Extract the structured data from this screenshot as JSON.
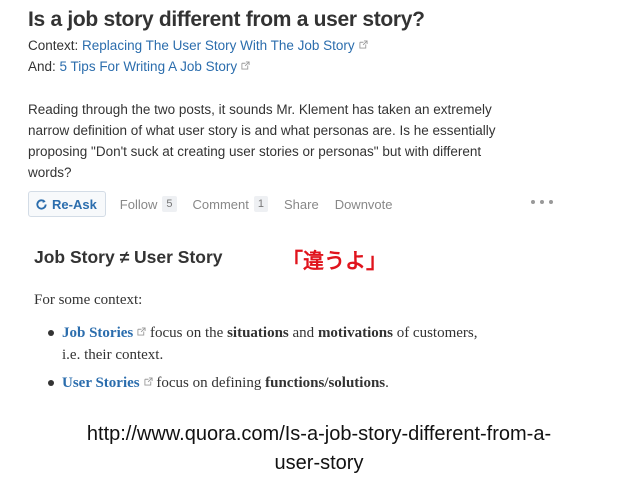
{
  "question": {
    "title": "Is a job story different from a user story?",
    "context_label": "Context:",
    "context_link": "Replacing The User Story With The Job Story",
    "and_label": "And:",
    "and_link": "5 Tips For Writing A Job Story",
    "body_lines": [
      "Reading through the two posts, it sounds Mr. Klement has taken an extremely",
      "narrow definition of what user story is and what personas are. Is he essentially",
      "proposing \"Don't suck at creating user stories or personas\" but with different",
      "words?"
    ]
  },
  "actions": {
    "reask": "Re-Ask",
    "follow": "Follow",
    "follow_count": "5",
    "comment": "Comment",
    "comment_count": "1",
    "share": "Share",
    "downvote": "Downvote"
  },
  "answer": {
    "title": "Job Story ≠ User Story",
    "annotation": "「違うよ」",
    "intro": "For some context:",
    "bullets": [
      {
        "link": "Job Stories",
        "text_a": " focus on the ",
        "bold_a": "situations",
        "text_b": " and ",
        "bold_b": "motivations",
        "text_c": " of customers,",
        "line2": "i.e. their context."
      },
      {
        "link": "User Stories",
        "text_a": " focus on defining ",
        "bold_a": "functions/solutions",
        "text_c": "."
      }
    ]
  },
  "source_url": {
    "line1": "http://www.quora.com/Is-a-job-story-different-from-a-",
    "line2": "user-story"
  },
  "colors": {
    "link": "#2b6dad",
    "annotation": "#e0141d",
    "text": "#333333"
  }
}
